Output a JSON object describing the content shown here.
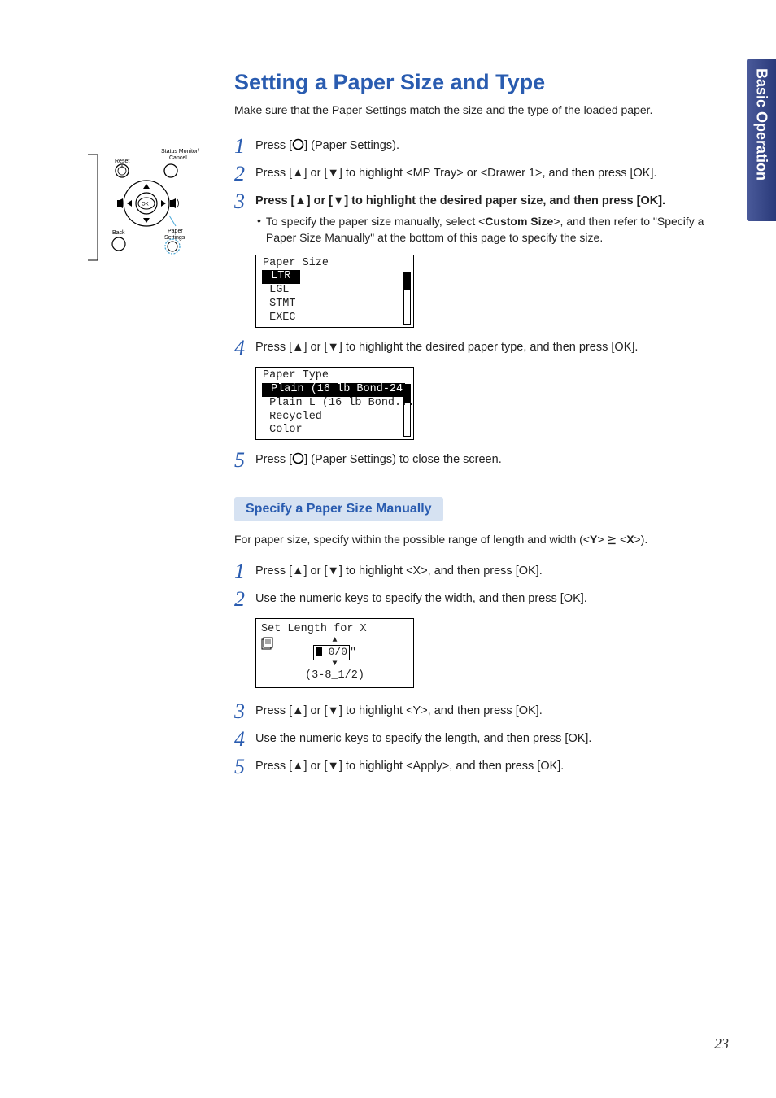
{
  "sideTab": "Basic Operation",
  "title": "Setting a Paper Size and Type",
  "intro": "Make sure that the Paper Settings match the size and the type of the loaded paper.",
  "steps": {
    "s1": {
      "num": "1",
      "pre": "Press [",
      "iconName": "circle-icon",
      "post": "] (Paper Settings)."
    },
    "s2": {
      "num": "2",
      "pre": "Press [",
      "up": "▲",
      "mid1": "] or [",
      "down": "▼",
      "mid2": "] to highlight <",
      "b1": "MP Tray",
      "mid3": "> or <",
      "b2": "Drawer 1",
      "post": ">, and then press [OK]."
    },
    "s3": {
      "num": "3",
      "pre": "Press [",
      "up": "▲",
      "mid1": "] or [",
      "down": "▼",
      "post": "] to highlight the desired paper size, and then press [OK].",
      "bulletPre": "To specify the paper size manually, select <",
      "bulletBold": "Custom Size",
      "bulletPost": ">, and then refer to \"Specify a Paper Size Manually\" at the bottom of this page to specify the size."
    },
    "s4": {
      "num": "4",
      "pre": "Press [",
      "up": "▲",
      "mid1": "] or [",
      "down": "▼",
      "post": "] to highlight the desired paper type, and then press [OK]."
    },
    "s5": {
      "num": "5",
      "pre": "Press [",
      "iconName": "circle-icon",
      "post": "] (Paper Settings) to close the screen."
    }
  },
  "lcd1": {
    "title": "Paper Size",
    "sel": " LTR ",
    "r2": " LGL",
    "r3": " STMT",
    "r4": " EXEC"
  },
  "lcd2": {
    "title": "Paper Type",
    "sel": " Plain (16 lb Bond-24",
    "r2": " Plain L (16 lb Bond...",
    "r3": " Recycled",
    "r4": " Color"
  },
  "sub": {
    "heading": "Specify a Paper Size Manually",
    "intro_pre": "For paper size, specify within the possible range of length and width (<",
    "intro_b1": "Y",
    "intro_mid": "> ≧ <",
    "intro_b2": "X",
    "intro_post": ">).",
    "s1": {
      "num": "1",
      "pre": "Press [",
      "up": "▲",
      "mid1": "] or [",
      "down": "▼",
      "post": "] to highlight <X>, and then press [OK]."
    },
    "s2": {
      "num": "2",
      "text": "Use the numeric keys to specify the width, and then press [OK]."
    },
    "s3": {
      "num": "3",
      "pre": "Press [",
      "up": "▲",
      "mid1": "] or [",
      "down": "▼",
      "post": "] to highlight <Y>, and then press [OK]."
    },
    "s4": {
      "num": "4",
      "text": "Use the numeric keys to specify the length, and then press [OK]."
    },
    "s5": {
      "num": "5",
      "pre": "Press [",
      "up": "▲",
      "mid1": "] or [",
      "down": "▼",
      "post": "] to highlight <Apply>, and then press [OK]."
    }
  },
  "lcd3": {
    "title": "Set Length for X",
    "val": "_0/0",
    "unit": "\"",
    "range": "(3-8_1/2)"
  },
  "panel": {
    "reset": "Reset",
    "status": "Status Monitor/",
    "cancel": "Cancel",
    "back": "Back",
    "ok": "OK",
    "paper": "Paper",
    "settings": "Settings"
  },
  "pageNum": "23"
}
